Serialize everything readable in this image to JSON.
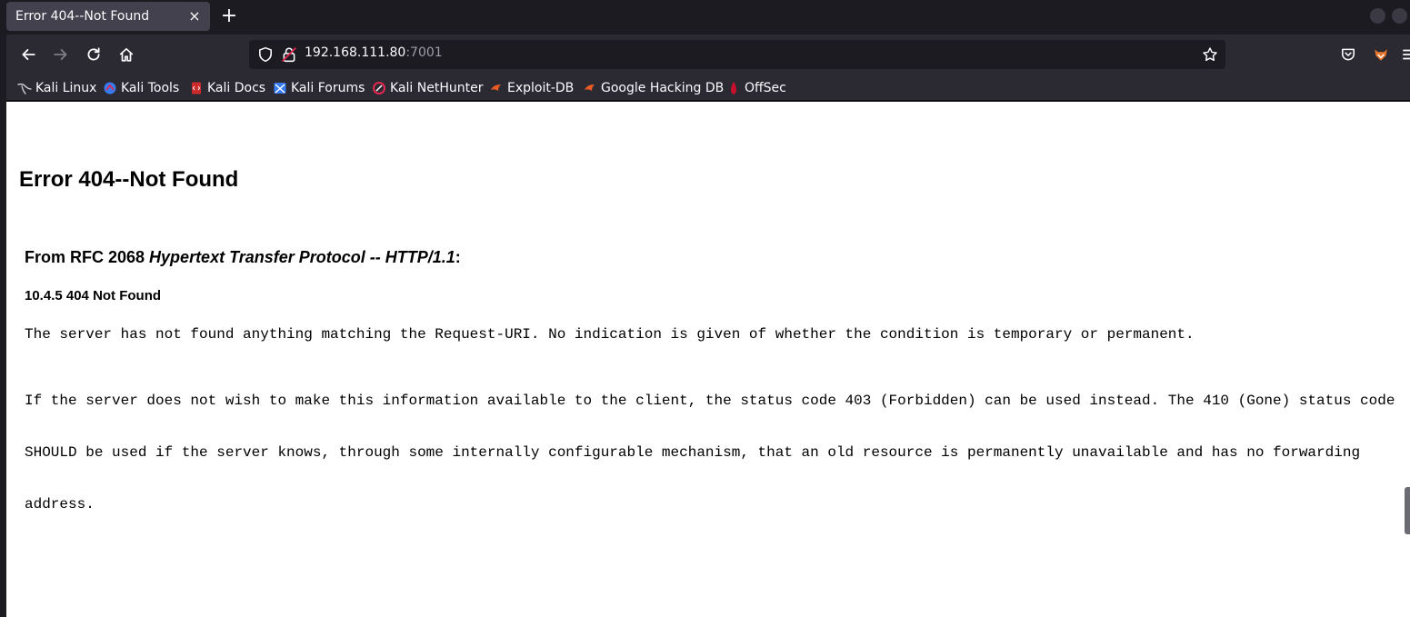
{
  "browser": {
    "tab": {
      "title": "Error 404--Not Found",
      "close_glyph": "×"
    },
    "new_tab_glyph": "+",
    "url": {
      "host": "192.168.111.80",
      "port": ":7001"
    },
    "icons": {
      "back": "arrow-left-icon",
      "forward": "arrow-right-icon",
      "reload": "reload-icon",
      "home": "home-icon",
      "shield": "shield-icon",
      "lock": "insecure-lock-icon",
      "bookmark_star": "star-icon",
      "pocket": "pocket-icon",
      "extension": "fox-extension-icon",
      "menu": "hamburger-menu-icon"
    },
    "bookmarks": [
      {
        "label": "Kali Linux",
        "icon": "kali-dragon-icon"
      },
      {
        "label": "Kali Tools",
        "icon": "kali-tools-icon"
      },
      {
        "label": "Kali Docs",
        "icon": "kali-docs-icon"
      },
      {
        "label": "Kali Forums",
        "icon": "kali-forums-icon"
      },
      {
        "label": "Kali NetHunter",
        "icon": "nethunter-icon"
      },
      {
        "label": "Exploit-DB",
        "icon": "exploit-db-icon"
      },
      {
        "label": "Google Hacking DB",
        "icon": "ghdb-icon"
      },
      {
        "label": "OffSec",
        "icon": "offsec-icon"
      }
    ]
  },
  "page": {
    "heading": "Error 404--Not Found",
    "rfc": {
      "prefix": "From RFC 2068 ",
      "title": "Hypertext Transfer Protocol -- HTTP/1.1",
      "suffix": ":"
    },
    "section": "10.4.5 404 Not Found",
    "paragraph1": "The server has not found anything matching the Request-URI. No indication is given of whether the condition is temporary or permanent.",
    "paragraph2_lines": [
      "If the server does not wish to make this information available to the client, the status code 403 (Forbidden) can be used instead. The 410 (Gone) status code",
      "SHOULD be used if the server knows, through some internally configurable mechanism, that an old resource is permanently unavailable and has no forwarding",
      "address."
    ]
  },
  "colors": {
    "chrome_dark": "#1c1b22",
    "toolbar": "#2b2a33",
    "tab_active": "#42414d",
    "text_light": "#fbfbfe",
    "insecure_red": "#e22850",
    "page_bg": "#ffffff"
  }
}
